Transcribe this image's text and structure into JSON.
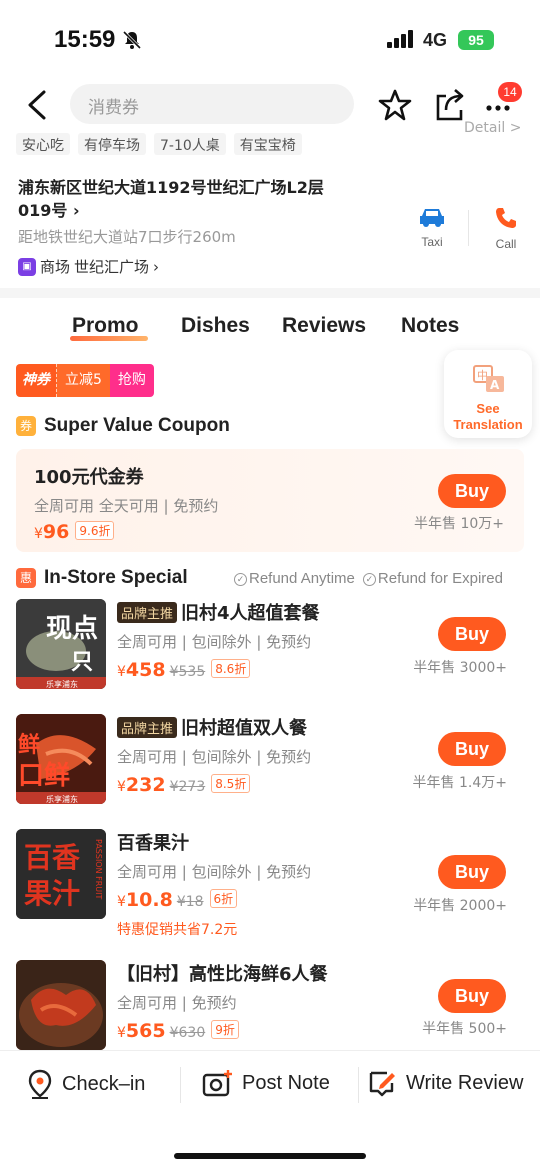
{
  "status_bar": {
    "time": "15:59",
    "network": "4G",
    "battery": "95"
  },
  "nav": {
    "search_placeholder": "消费券",
    "notification_count": "14"
  },
  "tags": [
    "安心吃",
    "有停车场",
    "7-10人桌",
    "有宝宝椅"
  ],
  "detail_link": "Detail >",
  "address": {
    "line": "浦东新区世纪大道1192号世纪汇广场L2层019号",
    "distance": "距地铁世纪大道站7口步行260m",
    "mall_label": "商场",
    "mall_name": "世纪汇广场"
  },
  "actions": {
    "taxi": "Taxi",
    "call": "Call"
  },
  "tabs": [
    "Promo",
    "Dishes",
    "Reviews",
    "Notes"
  ],
  "promo_banner": {
    "brand": "神券",
    "discount": "立减5",
    "grab": "抢购"
  },
  "translate": {
    "label_1": "See",
    "label_2": "Translation"
  },
  "super_value": {
    "icon_text": "券",
    "title": "Super Value Coupon",
    "coupon": {
      "title": "100元代金券",
      "meta": "全周可用 全天可用 | 免预约",
      "price": "96",
      "discount": "9.6折",
      "buy": "Buy",
      "sold": "半年售 10万+"
    }
  },
  "instore": {
    "icon_text": "惠",
    "title": "In-Store Special",
    "guarantee_1": "Refund Anytime",
    "guarantee_2": "Refund for Expired"
  },
  "deals": [
    {
      "badge": "品牌主推",
      "title": "旧村4人超值套餐",
      "meta": "全周可用 | 包间除外 | 免预约",
      "price": "458",
      "orig": "¥535",
      "discount": "8.6折",
      "sold": "半年售 3000+",
      "buy": "Buy",
      "thumb_text": "现点只",
      "thumb_sub": "乐享浦东",
      "thumb_color": "#3b3b3b"
    },
    {
      "badge": "品牌主推",
      "title": "旧村超值双人餐",
      "meta": "全周可用 | 包间除外 | 免预约",
      "price": "232",
      "orig": "¥273",
      "discount": "8.5折",
      "sold": "半年售 1.4万+",
      "buy": "Buy",
      "thumb_text": "口鲜",
      "thumb_sub": "乐享浦东",
      "thumb_color": "#5a1e12"
    },
    {
      "badge": "",
      "title": "百香果汁",
      "meta": "全周可用 | 包间除外 | 免预约",
      "price": "10.8",
      "orig": "¥18",
      "discount": "6折",
      "sold": "半年售 2000+",
      "buy": "Buy",
      "note": "特惠促销共省7.2元",
      "thumb_text": "百香果汁",
      "thumb_sub": "PASSION FRUIT",
      "thumb_color": "#2a2a2a"
    },
    {
      "badge": "",
      "title": "【旧村】高性比海鲜6人餐",
      "meta": "全周可用 | 免预约",
      "price": "565",
      "orig": "¥630",
      "discount": "9折",
      "sold": "半年售 500+",
      "buy": "Buy",
      "thumb_text": "",
      "thumb_sub": "",
      "thumb_color": "#7a2a1a"
    }
  ],
  "bottom_bar": {
    "checkin": "Check–in",
    "post_note": "Post Note",
    "write_review": "Write Review"
  },
  "colors": {
    "accent": "#ff5a1f",
    "pink": "#ff2e8b"
  }
}
